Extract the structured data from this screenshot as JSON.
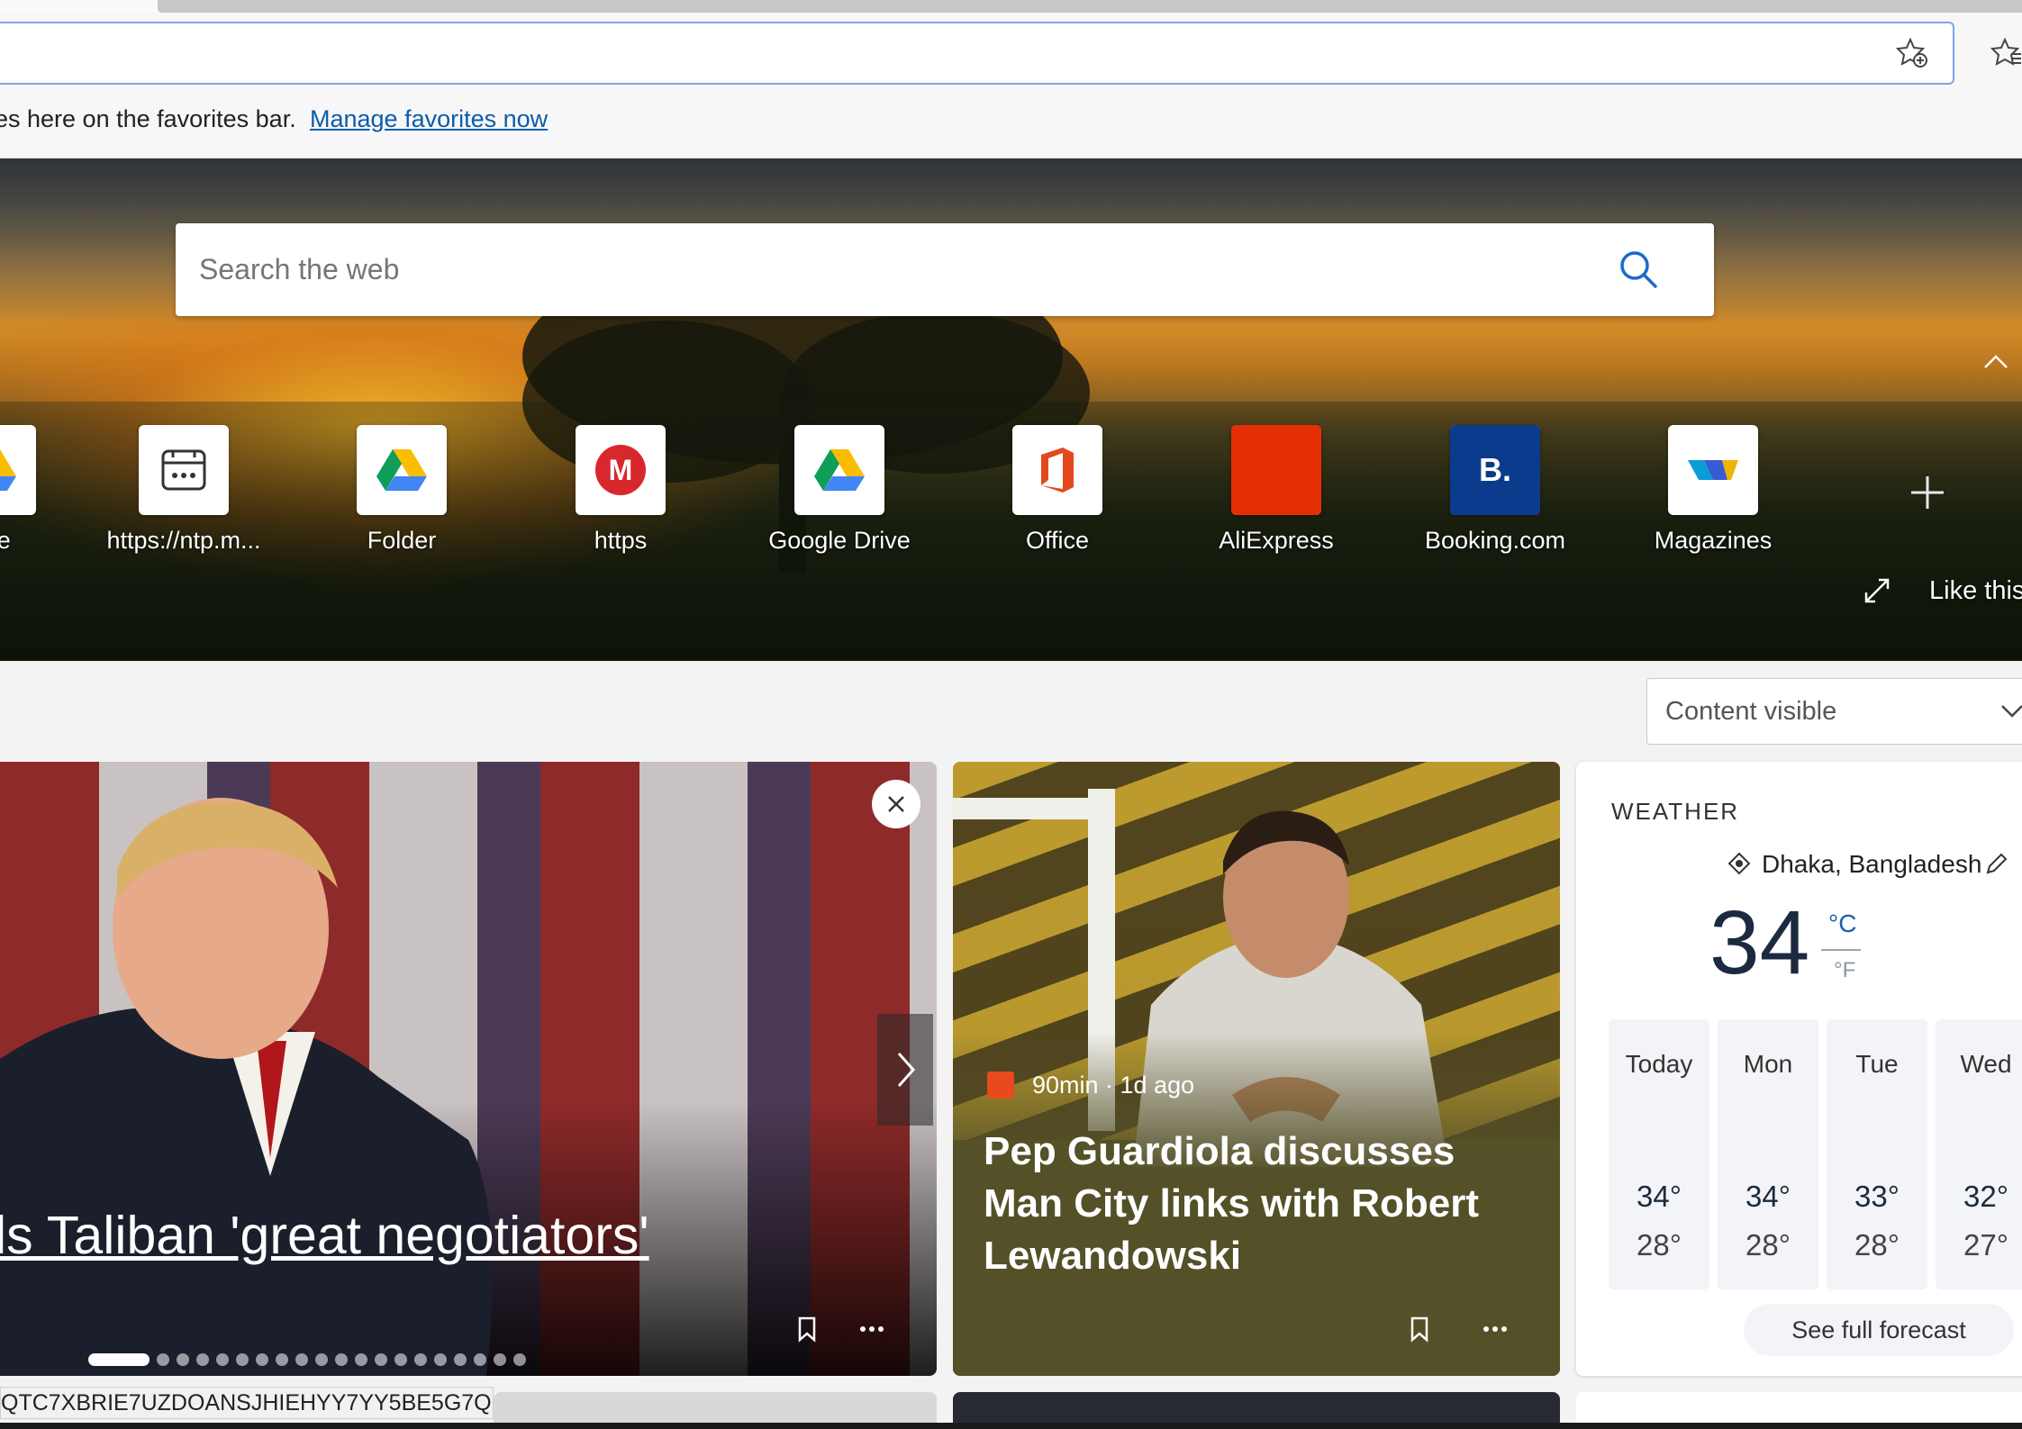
{
  "address_bar": {
    "value": ""
  },
  "favorites_bar": {
    "message": "es here on the favorites bar.",
    "link": "Manage favorites now"
  },
  "search": {
    "placeholder": "Search the web"
  },
  "quick_links": [
    {
      "label": "rive",
      "icon": "google-drive-icon"
    },
    {
      "label": "https://ntp.m...",
      "icon": "page-icon"
    },
    {
      "label": "Folder",
      "icon": "google-drive-icon"
    },
    {
      "label": "https",
      "icon": "mega-icon"
    },
    {
      "label": "Google Drive",
      "icon": "google-drive-icon"
    },
    {
      "label": "Office",
      "icon": "office-icon"
    },
    {
      "label": "AliExpress",
      "icon": "aliexpress-icon"
    },
    {
      "label": "Booking.com",
      "icon": "booking-icon"
    },
    {
      "label": "Magazines",
      "icon": "magazines-icon"
    }
  ],
  "booking_letter": "B.",
  "mega_letter": "M",
  "hero": {
    "like_text": "Like this"
  },
  "content_toggle": {
    "label": "Content visible"
  },
  "news": [
    {
      "title": "ls Taliban 'great negotiators'"
    },
    {
      "source": "90min · 1d ago",
      "title": "Pep Guardiola discusses Man City links with Robert Lewandowski"
    }
  ],
  "weather": {
    "title": "WEATHER",
    "location": "Dhaka, Bangladesh",
    "temperature": "34",
    "unit_c": "°C",
    "unit_f": "°F",
    "days": [
      {
        "name": "Today",
        "high": "34°",
        "low": "28°"
      },
      {
        "name": "Mon",
        "high": "34°",
        "low": "28°"
      },
      {
        "name": "Tue",
        "high": "33°",
        "low": "28°"
      },
      {
        "name": "Wed",
        "high": "32°",
        "low": "27°"
      }
    ],
    "forecast_link": "See full forecast"
  },
  "status_url": "QTC7XBRIE7UZDOANSJHIEHYY7YY5BE5G7Q...",
  "colors": {
    "accent": "#0b5cad",
    "address_border": "#7aa7e6",
    "temp_text": "#1b2a3f"
  }
}
